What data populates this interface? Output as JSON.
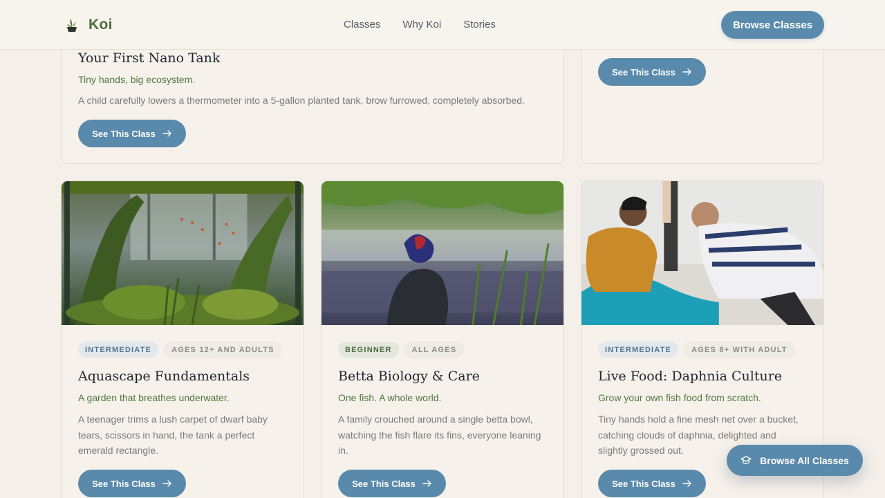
{
  "brand": {
    "name": "Koi",
    "logo_icon": "koi-plant-logo-icon"
  },
  "nav": {
    "items": [
      "Classes",
      "Why Koi",
      "Stories"
    ]
  },
  "header": {
    "cta_label": "Browse Classes"
  },
  "colors": {
    "accent": "#5a8aab",
    "brand_green": "#4d6b3e",
    "background": "#f4efe9"
  },
  "top_cards": [
    {
      "title": "Your First Nano Tank",
      "subtitle": "Tiny hands, big ecosystem.",
      "description": "A child carefully lowers a thermometer into a 5-gallon planted tank, brow furrowed, completely absorbed.",
      "button_label": "See This Class"
    },
    {
      "button_label": "See This Class"
    }
  ],
  "cards": [
    {
      "level": "INTERMEDIATE",
      "ages": "AGES 12+ AND ADULTS",
      "title": "Aquascape Fundamentals",
      "subtitle": "A garden that breathes underwater.",
      "description": "A teenager trims a lush carpet of dwarf baby tears, scissors in hand, the tank a perfect emerald rectangle.",
      "button_label": "See This Class"
    },
    {
      "level": "BEGINNER",
      "ages": "ALL AGES",
      "title": "Betta Biology & Care",
      "subtitle": "One fish. A whole world.",
      "description": "A family crouched around a single betta bowl, watching the fish flare its fins, everyone leaning in.",
      "button_label": "See This Class"
    },
    {
      "level": "INTERMEDIATE",
      "ages": "AGES 8+ WITH ADULT",
      "title": "Live Food: Daphnia Culture",
      "subtitle": "Grow your own fish food from scratch.",
      "description": "Tiny hands hold a fine mesh net over a bucket, catching clouds of daphnia, delighted and slightly grossed out.",
      "button_label": "See This Class"
    }
  ],
  "fab": {
    "label": "Browse All Classes",
    "icon": "graduation-cap-icon"
  }
}
